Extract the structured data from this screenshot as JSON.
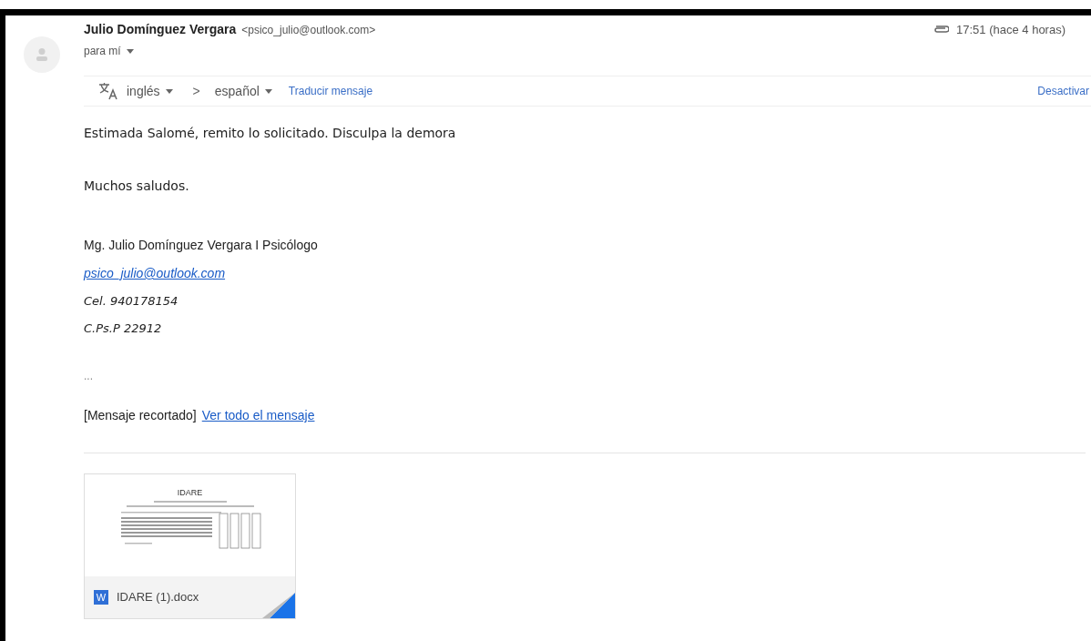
{
  "sender": {
    "name": "Julio Domínguez Vergara",
    "email": "<psico_julio@outlook.com>",
    "recipient": "para mí"
  },
  "meta": {
    "time": "17:51 (hace 4 horas)",
    "has_attachment": true
  },
  "translate_bar": {
    "from": "inglés",
    "separator": ">",
    "to": "español",
    "action": "Traducir mensaje",
    "disable": "Desactivar"
  },
  "body": {
    "greeting": "Estimada Salomé, remito lo solicitado. Disculpa la demora",
    "closing": "Muchos saludos.",
    "signature": [
      {
        "kind": "plain",
        "text": "Mg. Julio Domínguez Vergara I Psicólogo"
      },
      {
        "kind": "link",
        "text": "psico_julio@outlook.com"
      },
      {
        "kind": "italic",
        "text": "Cel. 940178154"
      },
      {
        "kind": "italic",
        "text": "C.Ps.P 22912"
      }
    ],
    "ellipsis": "...",
    "trimmed": "[Mensaje recortado]",
    "view_all": "Ver todo el mensaje"
  },
  "attachments": [
    {
      "preview_title": "IDARE",
      "type_letter": "W",
      "filename": "IDARE (1).docx"
    }
  ]
}
